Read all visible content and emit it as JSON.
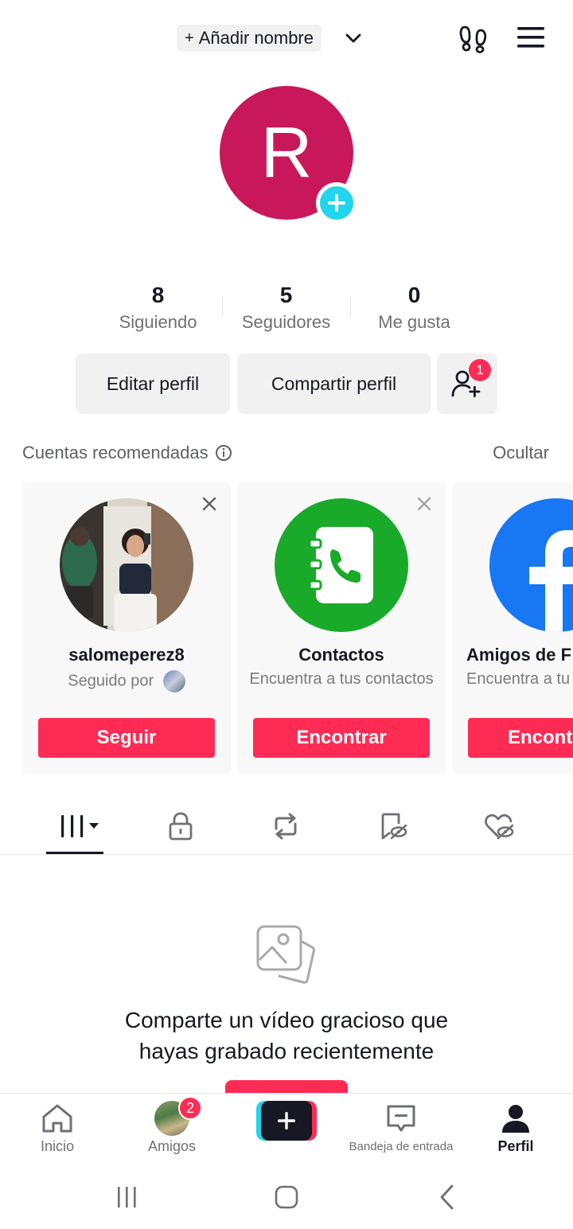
{
  "header": {
    "add_name_plus": "+",
    "add_name_label": "Añadir nombre"
  },
  "profile": {
    "avatar_letter": "R",
    "avatar_color": "#c8185a",
    "accent_plus_color": "#20d5ec"
  },
  "stats": [
    {
      "value": "8",
      "label": "Siguiendo"
    },
    {
      "value": "5",
      "label": "Seguidores"
    },
    {
      "value": "0",
      "label": "Me gusta"
    }
  ],
  "buttons": {
    "edit": "Editar perfil",
    "share": "Compartir perfil",
    "add_friend_badge": "1"
  },
  "recommended": {
    "title": "Cuentas recomendadas",
    "hide": "Ocultar",
    "cards": [
      {
        "name": "salomeperez8",
        "subtitle": "Seguido por",
        "button": "Seguir"
      },
      {
        "name": "Contactos",
        "subtitle": "Encuentra a tus contactos",
        "button": "Encontrar"
      },
      {
        "name": "Amigos de F",
        "subtitle": "Encuentra a tu",
        "button": "Encont"
      }
    ]
  },
  "tabs": [
    "videos-grid-icon",
    "lock-icon",
    "repost-icon",
    "hidden-bookmark-icon",
    "hidden-heart-icon"
  ],
  "empty_state": {
    "text_line1": "Comparte un vídeo gracioso que",
    "text_line2": "hayas grabado recientemente"
  },
  "bottom_nav": {
    "home": "Inicio",
    "friends": "Amigos",
    "friends_badge": "2",
    "inbox": "Bandeja de entrada",
    "profile": "Perfil"
  },
  "colors": {
    "brand_red": "#fe2c55",
    "brand_cyan": "#20d5ec",
    "contacts_green": "#1aaa2a",
    "facebook_blue": "#1877f2"
  }
}
